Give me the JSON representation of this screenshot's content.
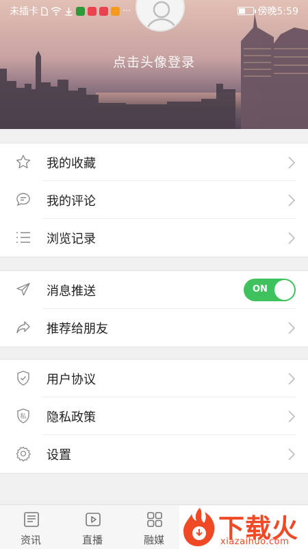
{
  "status_bar": {
    "carrier": "未插卡",
    "time": "傍晚5:59",
    "battery_level": 0.45
  },
  "profile": {
    "login_prompt": "点击头像登录"
  },
  "menu": {
    "group1": [
      {
        "label": "我的收藏",
        "icon": "star-icon"
      },
      {
        "label": "我的评论",
        "icon": "comment-icon"
      },
      {
        "label": "浏览记录",
        "icon": "list-icon"
      }
    ],
    "group2": [
      {
        "label": "消息推送",
        "icon": "send-icon",
        "toggle": "ON",
        "toggle_on": true
      },
      {
        "label": "推荐给朋友",
        "icon": "share-icon"
      }
    ],
    "group3": [
      {
        "label": "用户协议",
        "icon": "shield-check-icon"
      },
      {
        "label": "隐私政策",
        "icon": "shield-private-icon",
        "icon_text": "私"
      },
      {
        "label": "设置",
        "icon": "gear-icon"
      }
    ]
  },
  "tabs": [
    {
      "label": "资讯",
      "icon": "news-icon"
    },
    {
      "label": "直播",
      "icon": "live-icon"
    },
    {
      "label": "融媒",
      "icon": "grid-icon"
    }
  ],
  "watermark": {
    "title": "下载火",
    "url": "xiazaihuo.com"
  },
  "colors": {
    "toggle_on": "#3fc25d",
    "watermark": "#ef4a25"
  }
}
